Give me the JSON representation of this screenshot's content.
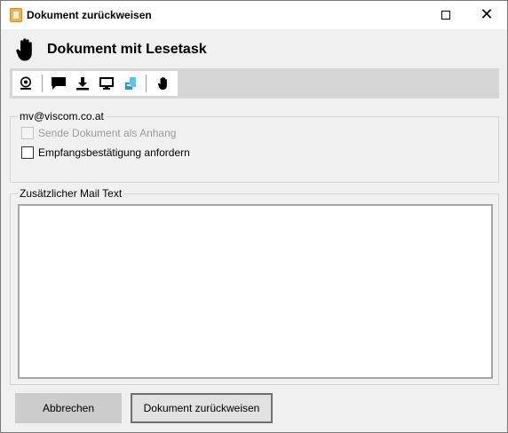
{
  "window": {
    "title": "Dokument zurückweisen",
    "maximize_icon": "maximize-icon",
    "close_icon": "close-icon"
  },
  "header": {
    "icon": "hand-stop-icon",
    "title": "Dokument mit Lesetask"
  },
  "toolbar": {
    "buttons": [
      {
        "name": "routing-icon"
      },
      {
        "name": "comment-icon"
      },
      {
        "name": "download-icon"
      },
      {
        "name": "monitor-icon"
      },
      {
        "name": "sharepoint-icon"
      },
      {
        "name": "hand-stop-icon"
      }
    ]
  },
  "email_group": {
    "legend": "mv@viscom.co.at",
    "send_attachment": {
      "label": "Sende Dokument als Anhang",
      "checked": false,
      "enabled": false
    },
    "read_receipt": {
      "label": "Empfangsbestätigung anfordern",
      "checked": false,
      "enabled": true
    }
  },
  "mail_text_group": {
    "legend": "Zusätzlicher Mail Text",
    "value": ""
  },
  "buttons": {
    "cancel": "Abbrechen",
    "reject": "Dokument zurückweisen"
  },
  "colors": {
    "toolbar_bg": "#d6d6d6",
    "window_bg": "#f0f0f0",
    "sharepoint_blue": "#1e9ad6"
  }
}
